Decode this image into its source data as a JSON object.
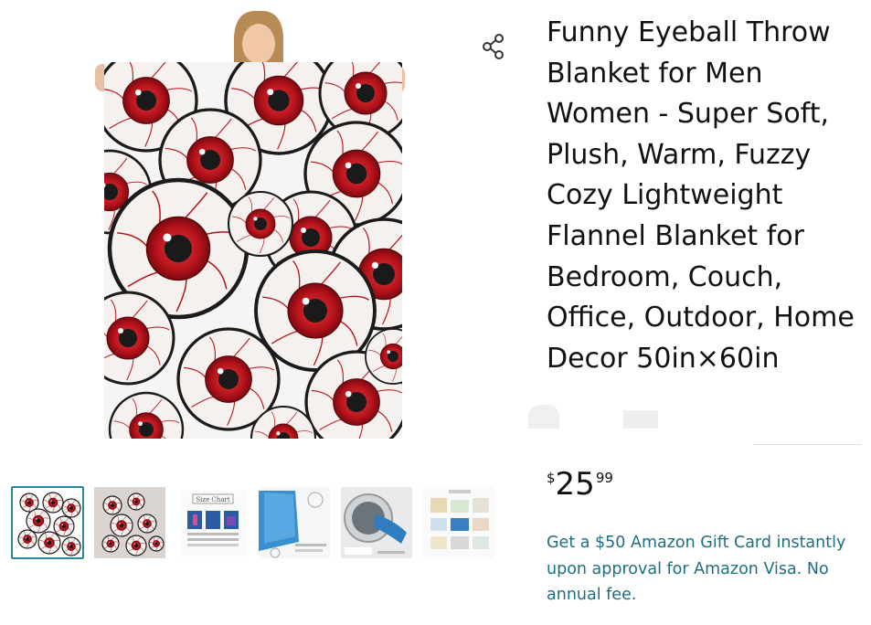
{
  "product": {
    "title": "Funny Eyeball Throw Blanket for Men Women - Super Soft, Plush, Warm, Fuzzy Cozy Lightweight Flannel Blanket for Bedroom, Couch, Office, Outdoor, Home Decor 50in×60in",
    "price": {
      "symbol": "$",
      "whole": "25",
      "fraction": "99"
    },
    "promo": "Get a $50 Amazon Gift Card instantly upon approval for Amazon Visa. No annual fee."
  },
  "gallery": {
    "thumbnails": [
      {
        "name": "thumb-blanket-front",
        "selected": true
      },
      {
        "name": "thumb-blanket-draped",
        "selected": false
      },
      {
        "name": "thumb-size-chart",
        "label": "Size Chart",
        "selected": false
      },
      {
        "name": "thumb-material",
        "selected": false
      },
      {
        "name": "thumb-washing",
        "selected": false
      },
      {
        "name": "thumb-uses",
        "selected": false
      }
    ]
  },
  "icons": {
    "share": "share-icon"
  },
  "colors": {
    "link": "#1c6f80",
    "thumb_selected_border": "#2a8a9a",
    "eye_red": "#b5121b"
  }
}
